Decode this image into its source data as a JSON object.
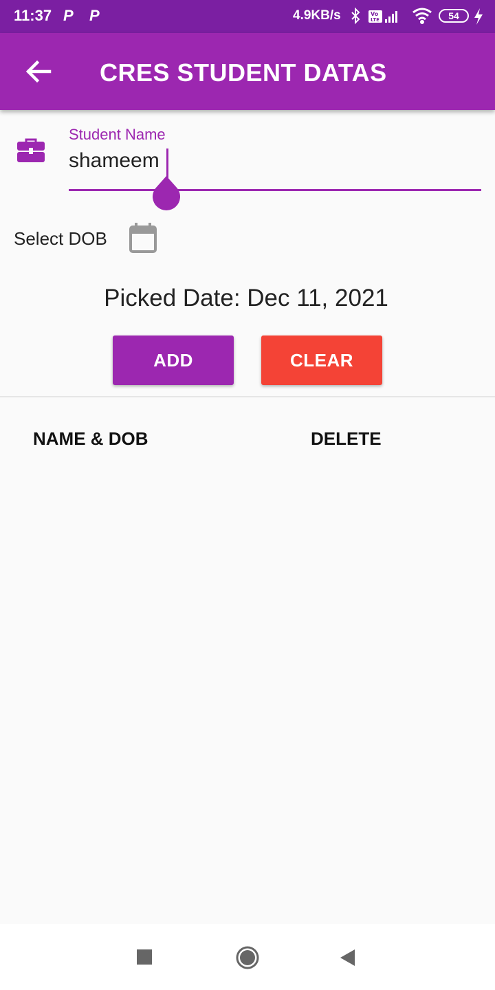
{
  "status_bar": {
    "time": "11:37",
    "notif_1": "P",
    "notif_2": "P",
    "speed": "4.9KB/s",
    "battery": "54"
  },
  "app_bar": {
    "title": "CRES STUDENT DATAS",
    "color": "#9c27b0"
  },
  "form": {
    "name_label": "Student Name",
    "name_value": "shameem",
    "dob_label": "Select DOB",
    "picked_date": "Picked Date: Dec 11, 2021"
  },
  "buttons": {
    "add_label": "ADD",
    "add_color": "#9c27b0",
    "clear_label": "CLEAR",
    "clear_color": "#f44336"
  },
  "table": {
    "headers": [
      "NAME & DOB",
      "DELETE"
    ],
    "rows": []
  },
  "nav": {
    "icons": [
      "recents-icon",
      "home-icon",
      "back-icon"
    ]
  }
}
